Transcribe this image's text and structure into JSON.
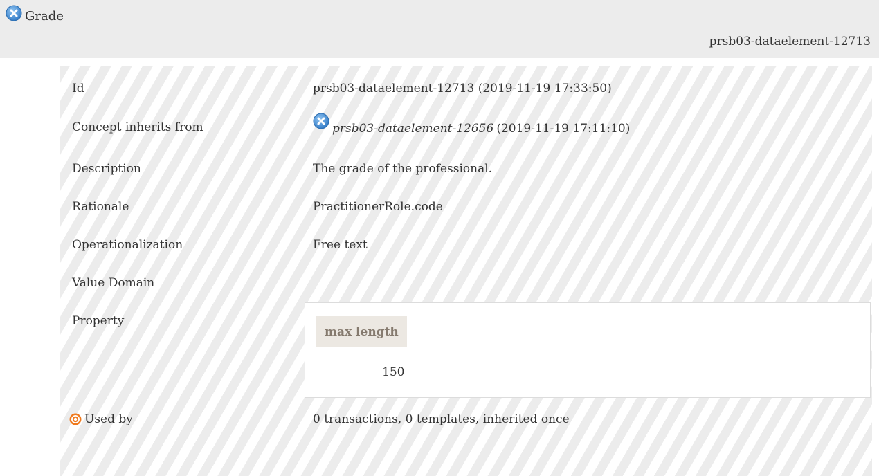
{
  "header": {
    "title": "Grade",
    "id": "prsb03-dataelement-12713"
  },
  "rows": {
    "id": {
      "label": "Id",
      "value": "prsb03-dataelement-12713 (2019-11-19 17:33:50)"
    },
    "inherits": {
      "label": "Concept inherits from",
      "link": "prsb03-dataelement-12656",
      "date": "(2019-11-19 17:11:10)"
    },
    "description": {
      "label": "Description",
      "value": "The grade of the professional."
    },
    "rationale": {
      "label": "Rationale",
      "value": "PractitionerRole.code"
    },
    "operationalization": {
      "label": "Operationalization",
      "value": "Free text"
    },
    "value_domain": {
      "label": "Value Domain"
    },
    "property": {
      "label": "Property",
      "header": "max length",
      "value": "150"
    },
    "used_by": {
      "label": "Used by",
      "value": "0 transactions, 0 templates, inherited once"
    }
  },
  "icons": {
    "title_icon": "close-circle-icon",
    "inherits_icon": "close-circle-icon",
    "used_by_icon": "target-icon"
  },
  "colors": {
    "icon_blue": "#4a90d9",
    "icon_orange": "#f07a1e",
    "property_header_bg": "#ece8e2",
    "property_header_text": "#857a6e"
  }
}
